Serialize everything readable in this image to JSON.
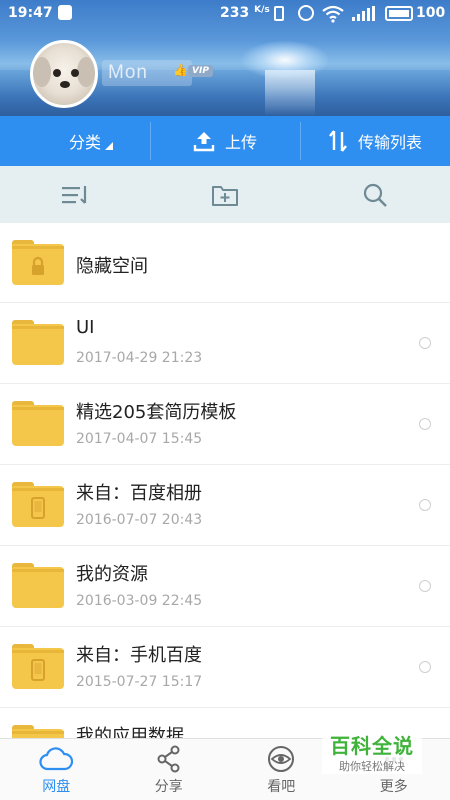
{
  "status_bar": {
    "time": "19:47",
    "net_speed": "233",
    "net_speed_unit": "K/s",
    "battery": "100"
  },
  "profile": {
    "username": "Mon",
    "vip_badge": "VIP"
  },
  "action_bar": {
    "category_label": "分类",
    "upload_label": "上传",
    "transfer_label": "传输列表"
  },
  "files": [
    {
      "name": "隐藏空间",
      "date": "",
      "icon": "lock-folder-icon"
    },
    {
      "name": "UI",
      "date": "2017-04-29  21:23",
      "icon": "folder-icon"
    },
    {
      "name": "精选205套简历模板",
      "date": "2017-04-07  15:45",
      "icon": "folder-icon"
    },
    {
      "name": "来自：百度相册",
      "date": "2016-07-07  20:43",
      "icon": "phone-folder-icon"
    },
    {
      "name": "我的资源",
      "date": "2016-03-09  22:45",
      "icon": "folder-icon"
    },
    {
      "name": "来自：手机百度",
      "date": "2015-07-27  15:17",
      "icon": "phone-folder-icon"
    },
    {
      "name": "我的应用数据",
      "date": "",
      "icon": "folder-icon"
    }
  ],
  "bottom_nav": {
    "items": [
      {
        "label": "网盘",
        "icon": "cloud-icon",
        "active": true
      },
      {
        "label": "分享",
        "icon": "share-icon",
        "active": false
      },
      {
        "label": "看吧",
        "icon": "eye-icon",
        "active": false
      },
      {
        "label": "更多",
        "icon": "more-icon",
        "active": false
      }
    ]
  },
  "watermark": {
    "title": "百科全说",
    "subtitle": "助你轻松解决"
  },
  "colors": {
    "accent": "#2f8ff0",
    "folder": "#f4c64a",
    "toolbar_bg": "#e5eef0"
  }
}
